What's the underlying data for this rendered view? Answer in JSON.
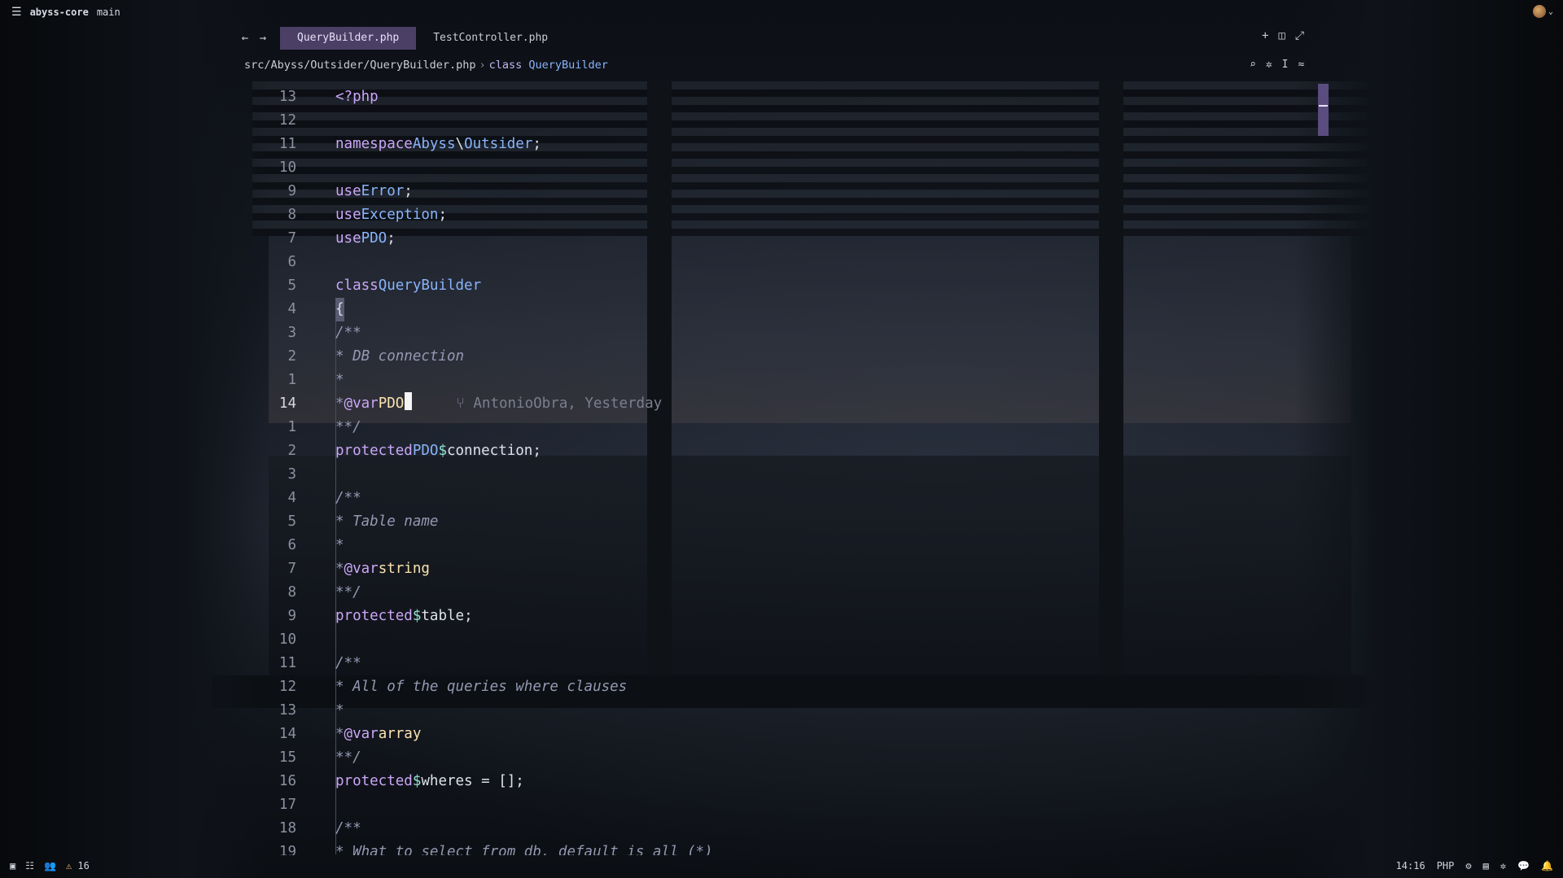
{
  "topbar": {
    "project": "abyss-core",
    "branch": "main"
  },
  "tabs": [
    {
      "label": "QueryBuilder.php"
    },
    {
      "label": "TestController.php"
    }
  ],
  "breadcrumb": {
    "path": "src/Abyss/Outsider/QueryBuilder.php",
    "separator": "›",
    "keyword": "class",
    "symbol": "QueryBuilder"
  },
  "editor": {
    "line_numbers": [
      "13",
      "12",
      "11",
      "10",
      "9",
      "8",
      "7",
      "6",
      "5",
      "4",
      "3",
      "2",
      "1",
      "14",
      "1",
      "2",
      "3",
      "4",
      "5",
      "6",
      "7",
      "8",
      "9",
      "10",
      "11",
      "12",
      "13",
      "14",
      "15",
      "16",
      "17",
      "18",
      "19"
    ],
    "blame": "AntonioObra, Yesterday",
    "code": {
      "php_open": "<?php",
      "namespace_kw": "namespace",
      "ns1": "Abyss",
      "ns_sep": "\\",
      "ns2": "Outsider",
      "semi": ";",
      "use_kw": "use",
      "use1": "Error",
      "use2": "Exception",
      "use3": "PDO",
      "class_kw": "class",
      "class_name": "QueryBuilder",
      "open_brace": "{",
      "doc_open": "/**",
      "doc_close": "**/",
      "star": "*",
      "c1": "* DB connection",
      "var_tag": "@var",
      "t_pdo": "PDO",
      "protected_kw": "protected",
      "dollar": "$",
      "v_connection": "connection",
      "c2": "* Table name",
      "t_string": "string",
      "v_table": "table",
      "c3": "* All of the queries where clauses",
      "t_array": "array",
      "v_wheres": "wheres",
      "assign": " = [];",
      "c4": "* What to select from db, default is all (*)"
    }
  },
  "statusbar": {
    "warnings": "16",
    "position": "14:16",
    "language": "PHP"
  },
  "icons": [
    "menu-icon",
    "avatar-icon",
    "chevron-down-icon",
    "back-arrow-icon",
    "forward-arrow-icon",
    "plus-icon",
    "split-icon",
    "maximize-icon",
    "search-icon",
    "sparkle-icon",
    "text-cursor-icon",
    "settings-sliders-icon",
    "branch-icon",
    "panel-icon",
    "outline-icon",
    "people-icon",
    "warning-icon",
    "debug-icon",
    "terminal-icon",
    "assistant-icon",
    "chat-icon",
    "bell-icon"
  ]
}
